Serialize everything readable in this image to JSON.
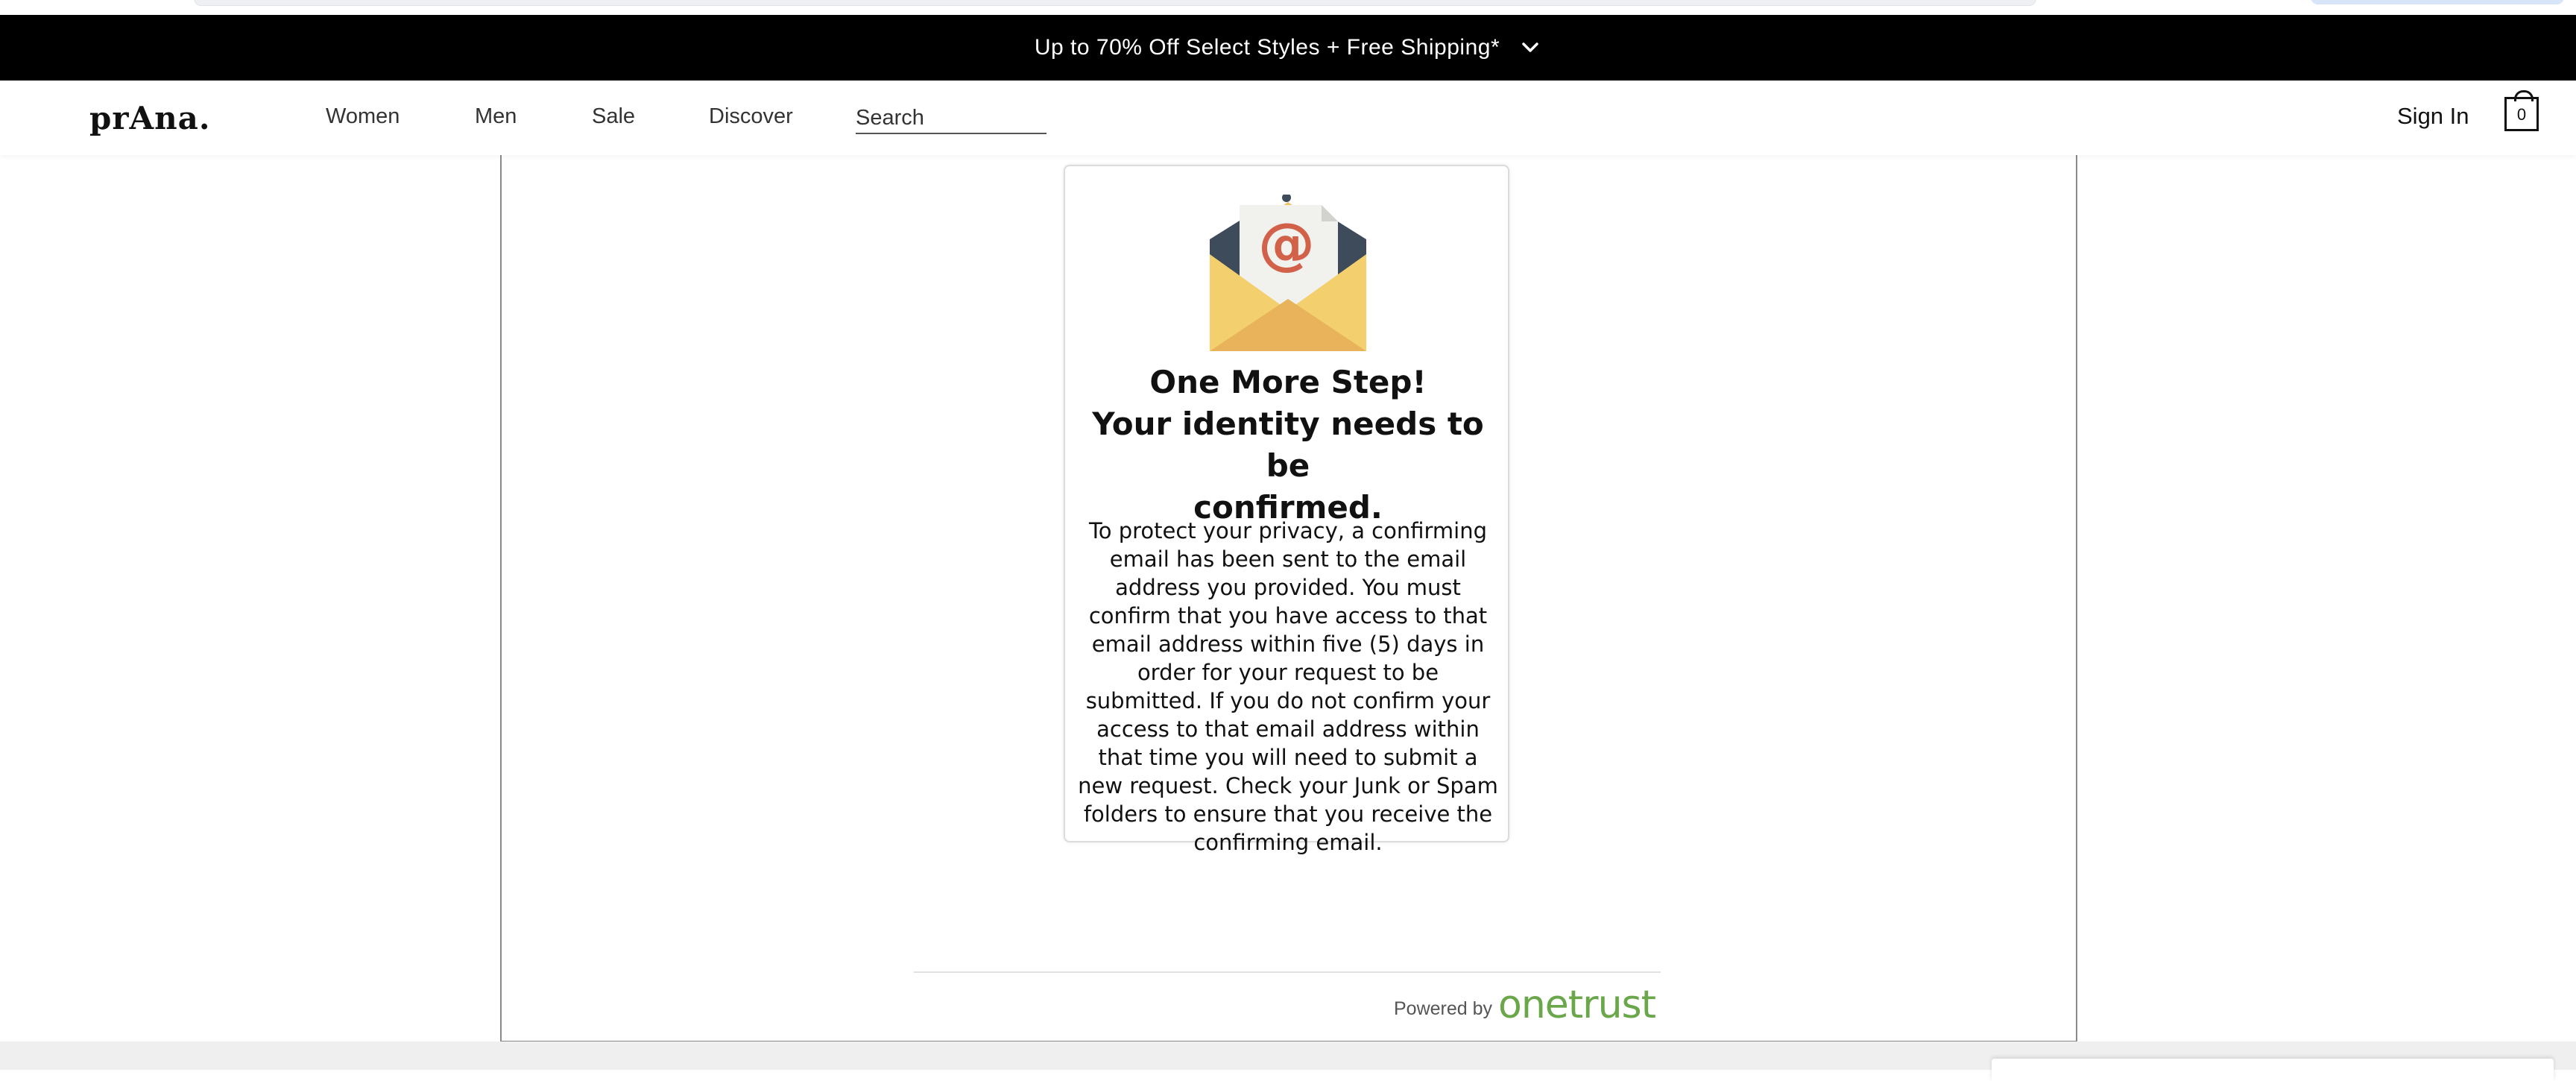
{
  "promo": {
    "text": "Up to 70% Off Select Styles + Free Shipping*",
    "chevron_icon": "chevron-down-icon"
  },
  "header": {
    "logo": "prAna.",
    "nav": [
      {
        "label": "Women"
      },
      {
        "label": "Men"
      },
      {
        "label": "Sale"
      },
      {
        "label": "Discover"
      }
    ],
    "search_placeholder": "Search",
    "sign_in": "Sign In",
    "cart_count": "0"
  },
  "confirmation": {
    "icon": "email-envelope-icon",
    "title_line1": "One More Step!",
    "title_line2": "Your identity needs to be",
    "title_line3": "confirmed.",
    "body": "To protect your privacy, a confirming email has been sent to the email address you provided. You must confirm that you have access to that email address within five (5) days in order for your request to be submitted. If you do not confirm your access to that email address within that time you will need to submit a new request. Check your Junk or Spam folders to ensure that you receive the confirming email."
  },
  "footer": {
    "powered_by": "Powered by",
    "brand": "onetrust",
    "brand_color": "#6aa64a"
  }
}
